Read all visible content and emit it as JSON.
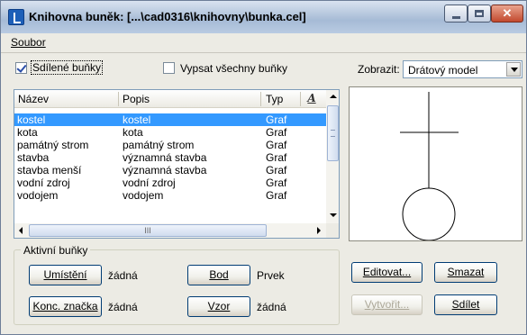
{
  "window": {
    "title": "Knihovna buněk: [...\\cad0316\\knihovny\\bunka.cel]"
  },
  "menu": {
    "soubor": "Soubor"
  },
  "options": {
    "shared_cells": {
      "label": "Sdílené buňky",
      "checked": true
    },
    "list_all_cells": {
      "label": "Vypsat všechny buňky",
      "checked": false
    }
  },
  "display": {
    "label": "Zobrazit:",
    "value": "Drátový model"
  },
  "list": {
    "headers": {
      "name": "Název",
      "description": "Popis",
      "type": "Typ"
    },
    "sort_icon": "A",
    "rows": [
      {
        "name": "kostel",
        "description": "kostel",
        "type": "Graf",
        "selected": true
      },
      {
        "name": "kota",
        "description": "kota",
        "type": "Graf"
      },
      {
        "name": "památný strom",
        "description": "památný strom",
        "type": "Graf"
      },
      {
        "name": "stavba",
        "description": "významná stavba",
        "type": "Graf"
      },
      {
        "name": "stavba menší",
        "description": "významná stavba",
        "type": "Graf"
      },
      {
        "name": "vodní zdroj",
        "description": "vodní zdroj",
        "type": "Graf"
      },
      {
        "name": "vodojem",
        "description": "vodojem",
        "type": "Graf"
      }
    ],
    "hscroll_grip": "III"
  },
  "active_cells": {
    "title": "Aktivní buňky",
    "placement": {
      "button": "Umístění",
      "value": "žádná"
    },
    "point": {
      "button": "Bod",
      "value": "Prvek"
    },
    "terminator": {
      "button": "Konc. značka",
      "value": "žádná"
    },
    "pattern": {
      "button": "Vzor",
      "value": "žádná"
    }
  },
  "actions": {
    "edit": "Editovat...",
    "delete": "Smazat",
    "create": "Vytvořit...",
    "share": "Sdílet"
  },
  "colors": {
    "selection": "#3399ff",
    "window_bg": "#ecebe4"
  },
  "icons": {
    "app": "cell-library-icon",
    "sort": "sort-icon"
  }
}
